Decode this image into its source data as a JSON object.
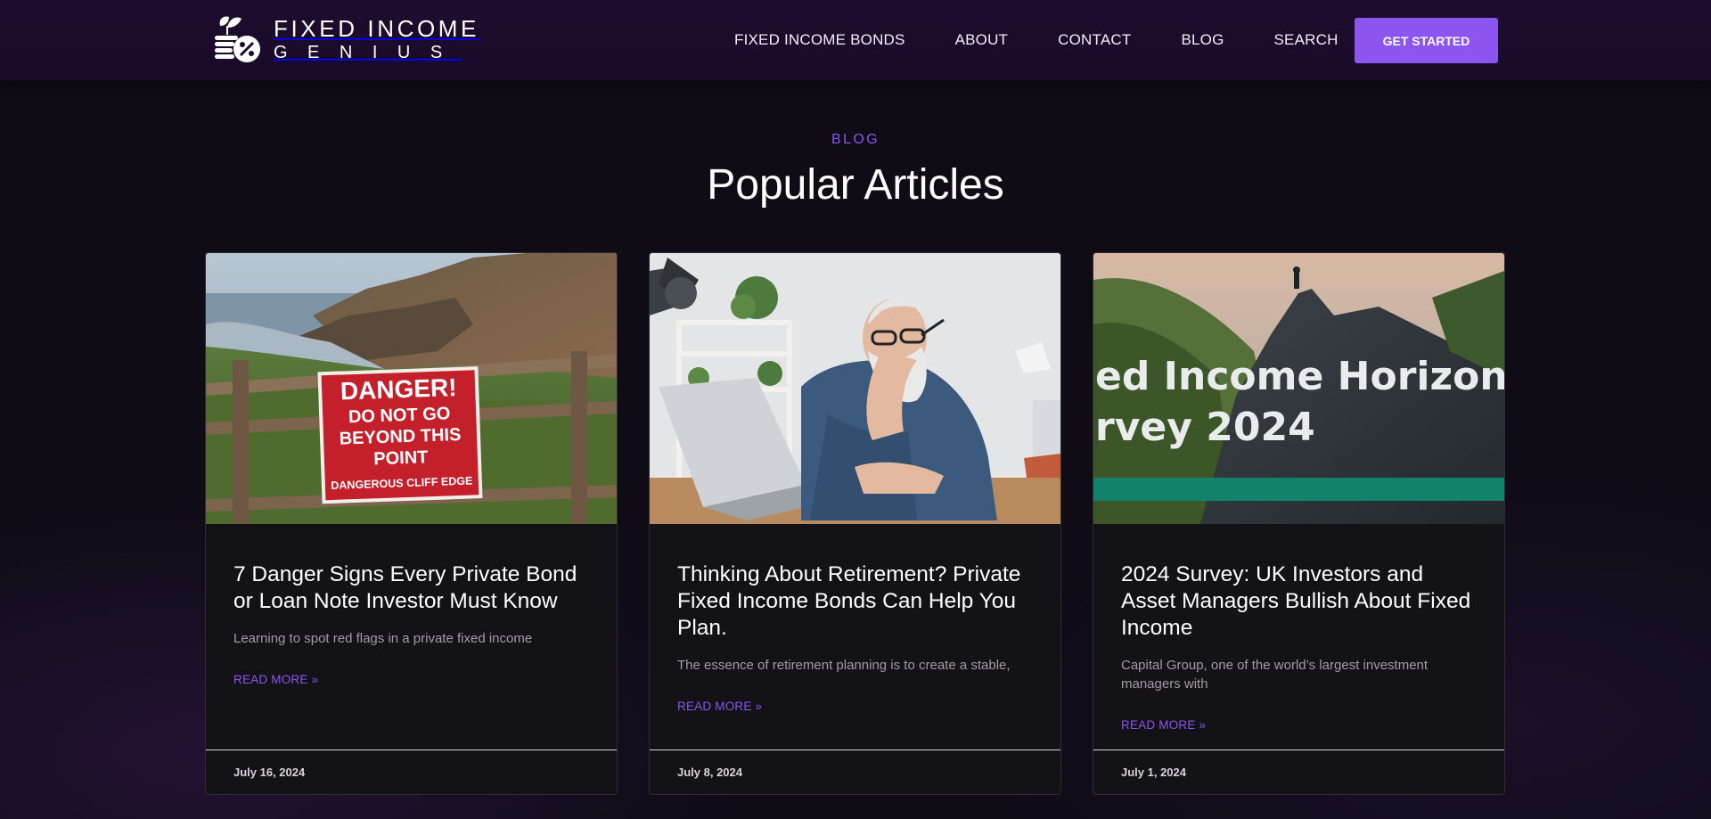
{
  "header": {
    "logo": {
      "line1": "FIXED INCOME",
      "line2": "GENIUS"
    },
    "nav": [
      "FIXED INCOME BONDS",
      "ABOUT",
      "CONTACT",
      "BLOG",
      "SEARCH"
    ],
    "cta_label": "GET STARTED"
  },
  "section": {
    "label": "BLOG",
    "title": "Popular Articles"
  },
  "articles": [
    {
      "image_alt": "Red danger sign on wooden fence at a cliff edge",
      "sign": {
        "l1": "DANGER!",
        "l2": "DO NOT GO",
        "l3": "BEYOND THIS",
        "l4": "POINT",
        "l5": "DANGEROUS CLIFF EDGE"
      },
      "title": "7 Danger Signs Every Private Bond or Loan Note Investor Must Know",
      "excerpt": "Learning to spot red flags in a private fixed income",
      "read_more": "READ MORE »",
      "date": "July 16, 2024"
    },
    {
      "image_alt": "Older man with glasses working on a laptop",
      "title": "Thinking About Retirement? Private Fixed Income Bonds Can Help You Plan.",
      "excerpt": "The essence of retirement planning is to create a stable,",
      "read_more": "READ MORE »",
      "date": "July 8, 2024"
    },
    {
      "image_alt": "Person standing on a mountain peak with overlay text",
      "overlay_line1": "ed Income Horizons",
      "overlay_line2": "rvey 2024",
      "title": "2024 Survey: UK Investors and Asset Managers Bullish About Fixed Income",
      "excerpt": "Capital Group, one of the world’s largest investment managers with",
      "read_more": "READ MORE »",
      "date": "July 1, 2024"
    }
  ],
  "colors": {
    "accent": "#8c55ef",
    "header_bg": "#1c0b2b",
    "page_bg": "#0f0c15",
    "card_bg": "#131216"
  }
}
